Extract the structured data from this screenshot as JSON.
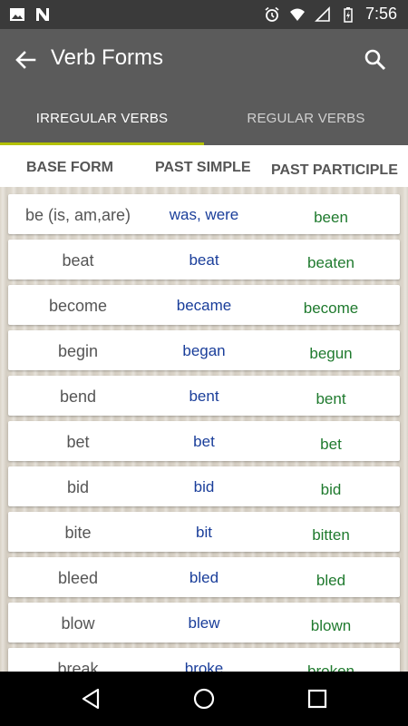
{
  "status_bar": {
    "time": "7:56",
    "left_icons": [
      "image-icon",
      "n-icon"
    ],
    "right_icons": [
      "alarm-icon",
      "wifi-icon",
      "signal-icon",
      "battery-icon"
    ]
  },
  "app_bar": {
    "title": "Verb Forms"
  },
  "tabs": [
    {
      "label": "IRREGULAR VERBS",
      "active": true
    },
    {
      "label": "REGULAR VERBS",
      "active": false
    }
  ],
  "columns": {
    "base": "BASE FORM",
    "past": "PAST SIMPLE",
    "participle": "PAST PARTICIPLE"
  },
  "verbs": [
    {
      "base": "be (is, am,are)",
      "past": "was, were",
      "participle": "been"
    },
    {
      "base": "beat",
      "past": "beat",
      "participle": "beaten"
    },
    {
      "base": "become",
      "past": "became",
      "participle": "become"
    },
    {
      "base": "begin",
      "past": "began",
      "participle": "begun"
    },
    {
      "base": "bend",
      "past": "bent",
      "participle": "bent"
    },
    {
      "base": "bet",
      "past": "bet",
      "participle": "bet"
    },
    {
      "base": "bid",
      "past": "bid",
      "participle": "bid"
    },
    {
      "base": "bite",
      "past": "bit",
      "participle": "bitten"
    },
    {
      "base": "bleed",
      "past": "bled",
      "participle": "bled"
    },
    {
      "base": "blow",
      "past": "blew",
      "participle": "blown"
    },
    {
      "base": "break",
      "past": "broke",
      "participle": "broken"
    }
  ],
  "colors": {
    "app_bar": "#5b5b5b",
    "tab_indicator": "#b4c100",
    "past_text": "#1a3e9a",
    "participle_text": "#1f7a2e"
  }
}
